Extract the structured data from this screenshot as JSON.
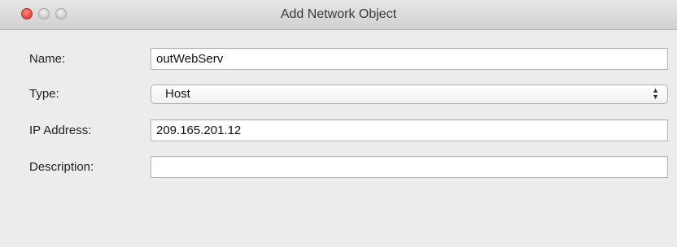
{
  "window": {
    "title": "Add Network Object"
  },
  "form": {
    "name_label": "Name:",
    "name_value": "outWebServ",
    "type_label": "Type:",
    "type_value": "Host",
    "ip_label": "IP Address:",
    "ip_value": "209.165.201.12",
    "description_label": "Description:",
    "description_value": ""
  },
  "icons": {
    "close": "close-icon",
    "minimize": "minimize-icon",
    "zoom": "zoom-icon",
    "select_arrows": "up-down-chevron-icon"
  },
  "colors": {
    "close_button": "#e0443a",
    "window_background": "#ececec"
  }
}
